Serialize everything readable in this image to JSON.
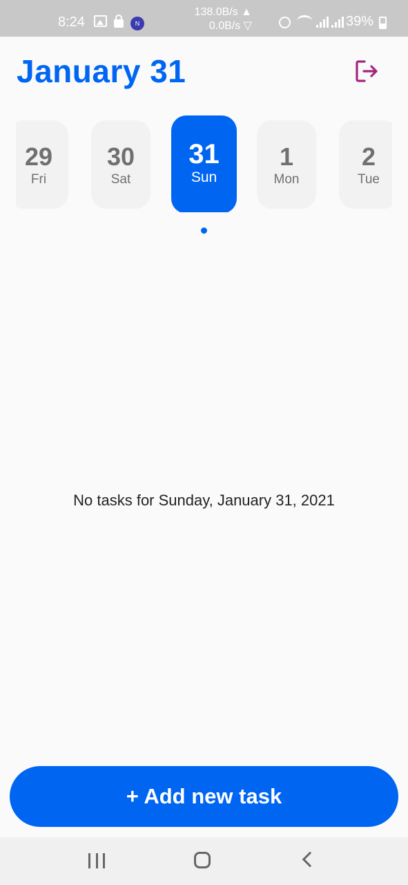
{
  "status_bar": {
    "time": "8:24",
    "net_up": "138.0B/s ▲",
    "net_down": "0.0B/s ▽",
    "battery": "39%",
    "icons": [
      "gallery-icon",
      "lock-icon",
      "nfc-icon",
      "alarm-icon",
      "wifi-icon",
      "signal-icon",
      "signal-icon",
      "battery-icon"
    ],
    "nfc_letter": "N"
  },
  "header": {
    "title": "January 31",
    "logout_icon": "logout-icon",
    "accent_color": "#0066f2",
    "logout_color": "#a3267e"
  },
  "dates": [
    {
      "num": "29",
      "day": "Fri",
      "selected": false
    },
    {
      "num": "30",
      "day": "Sat",
      "selected": false
    },
    {
      "num": "31",
      "day": "Sun",
      "selected": true
    },
    {
      "num": "1",
      "day": "Mon",
      "selected": false
    },
    {
      "num": "2",
      "day": "Tue",
      "selected": false
    }
  ],
  "main": {
    "empty_message": "No tasks for Sunday, January 31, 2021"
  },
  "footer": {
    "add_button_label": "+ Add new task"
  },
  "nav_bar": {
    "icons": [
      "recent-apps-icon",
      "home-icon",
      "back-icon"
    ]
  }
}
